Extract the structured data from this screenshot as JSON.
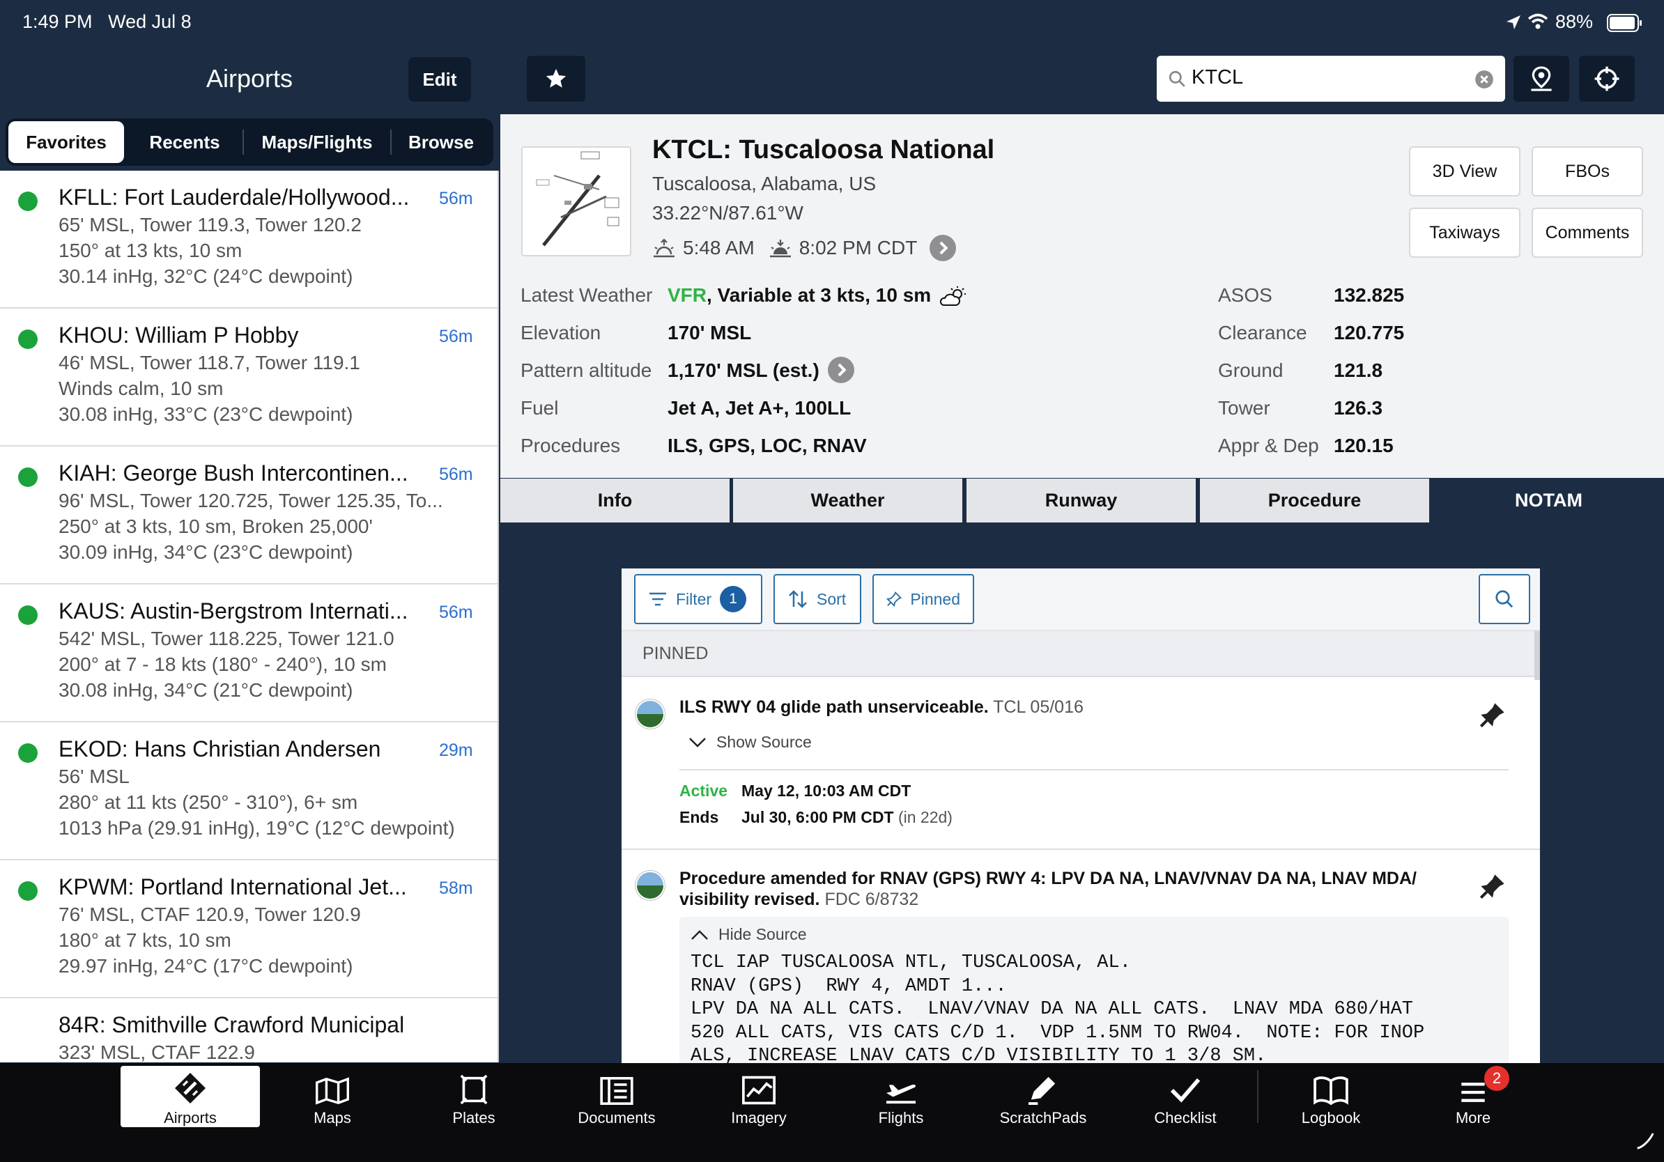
{
  "status_bar": {
    "time": "1:49 PM",
    "date": "Wed Jul 8",
    "battery": "88%"
  },
  "left_panel": {
    "title": "Airports",
    "edit_label": "Edit",
    "segments": [
      "Favorites",
      "Recents",
      "Maps/Flights",
      "Browse"
    ],
    "airports": [
      {
        "name": "KFLL: Fort Lauderdale/Hollywood...",
        "age": "56m",
        "lines": [
          "65' MSL, Tower 119.3, Tower 120.2",
          "150° at 13 kts, 10 sm",
          "30.14 inHg, 32°C (24°C dewpoint)"
        ],
        "status": "green"
      },
      {
        "name": "KHOU: William P Hobby",
        "age": "56m",
        "lines": [
          "46' MSL, Tower 118.7, Tower 119.1",
          "Winds calm, 10 sm",
          "30.08 inHg, 33°C (23°C dewpoint)"
        ],
        "status": "green"
      },
      {
        "name": "KIAH: George Bush Intercontinen...",
        "age": "56m",
        "lines": [
          "96' MSL, Tower 120.725, Tower 125.35, To...",
          "250° at 3 kts, 10 sm, Broken 25,000'",
          "30.09 inHg, 34°C (23°C dewpoint)"
        ],
        "status": "green"
      },
      {
        "name": "KAUS: Austin-Bergstrom Internati...",
        "age": "56m",
        "lines": [
          "542' MSL, Tower 118.225, Tower 121.0",
          "200° at 7 - 18 kts (180° - 240°), 10 sm",
          "30.08 inHg, 34°C (21°C dewpoint)"
        ],
        "status": "green"
      },
      {
        "name": "EKOD: Hans Christian Andersen",
        "age": "29m",
        "lines": [
          "56' MSL",
          "280° at 11 kts (250° - 310°), 6+ sm",
          "1013 hPa (29.91 inHg), 19°C (12°C dewpoint)"
        ],
        "status": "green"
      },
      {
        "name": "KPWM: Portland International Jet...",
        "age": "58m",
        "lines": [
          "76' MSL, CTAF 120.9, Tower 120.9",
          "180° at 7 kts, 10 sm",
          "29.97 inHg, 24°C (17°C dewpoint)"
        ],
        "status": "green"
      },
      {
        "name": "84R: Smithville Crawford Municipal",
        "age": "",
        "lines": [
          "323' MSL, CTAF 122.9"
        ],
        "status": "none"
      }
    ]
  },
  "search": {
    "value": "KTCL"
  },
  "airport": {
    "title": "KTCL: Tuscaloosa National",
    "location": "Tuscaloosa, Alabama, US",
    "coords": "33.22°N/87.61°W",
    "sunrise": "5:48 AM",
    "sunset": "8:02 PM CDT",
    "buttons": [
      "3D View",
      "FBOs",
      "Taxiways",
      "Comments"
    ],
    "weather_label": "Latest Weather",
    "weather_cat": "VFR",
    "weather_text": ", Variable at 3 kts, 10 sm",
    "details": [
      {
        "label": "Elevation",
        "value": "170' MSL"
      },
      {
        "label": "Pattern altitude",
        "value": "1,170' MSL (est.)"
      },
      {
        "label": "Fuel",
        "value": "Jet A, Jet A+, 100LL"
      },
      {
        "label": "Procedures",
        "value": "ILS, GPS, LOC, RNAV"
      }
    ],
    "freqs": [
      {
        "label": "ASOS",
        "value": "132.825"
      },
      {
        "label": "Clearance",
        "value": "120.775"
      },
      {
        "label": "Ground",
        "value": "121.8"
      },
      {
        "label": "Tower",
        "value": "126.3"
      },
      {
        "label": "Appr & Dep",
        "value": "120.15"
      }
    ]
  },
  "tabs": [
    "Info",
    "Weather",
    "Runway",
    "Procedure",
    "NOTAM"
  ],
  "notam": {
    "filter_label": "Filter",
    "filter_count": "1",
    "sort_label": "Sort",
    "pinned_label": "Pinned",
    "section": "PINNED",
    "items": [
      {
        "text": "ILS RWY 04 glide path unserviceable.",
        "ref": "TCL 05/016",
        "toggle": "Show Source",
        "active_label": "Active",
        "active_value": "May 12, 10:03 AM CDT",
        "ends_label": "Ends",
        "ends_value": "Jul 30, 6:00 PM CDT",
        "ends_rel": "(in 22d)"
      },
      {
        "text_line1": "Procedure amended for RNAV (GPS) RWY 4: LPV DA NA, LNAV/VNAV DA NA, LNAV MDA/",
        "text_line2": "visibility revised.",
        "ref": "FDC 6/8732",
        "toggle": "Hide Source",
        "source": [
          "TCL IAP TUSCALOOSA NTL, TUSCALOOSA, AL.",
          "RNAV (GPS)  RWY 4, AMDT 1...",
          "LPV DA NA ALL CATS.  LNAV/VNAV DA NA ALL CATS.  LNAV MDA 680/HAT",
          "520 ALL CATS, VIS CATS C/D 1.  VDP 1.5NM TO RW04.  NOTE: FOR INOP",
          "ALS, INCREASE LNAV CATS C/D VISIBILITY TO 1 3/8 SM."
        ]
      }
    ]
  },
  "tabbar": {
    "items": [
      "Airports",
      "Maps",
      "Plates",
      "Documents",
      "Imagery",
      "Flights",
      "ScratchPads",
      "Checklist",
      "Logbook",
      "More"
    ],
    "more_badge": "2"
  },
  "colors": {
    "nav_bg": "#1c2d43",
    "vfr_green": "#2fb344",
    "accent_blue": "#2a6fd1",
    "badge_red": "#e5302c"
  }
}
